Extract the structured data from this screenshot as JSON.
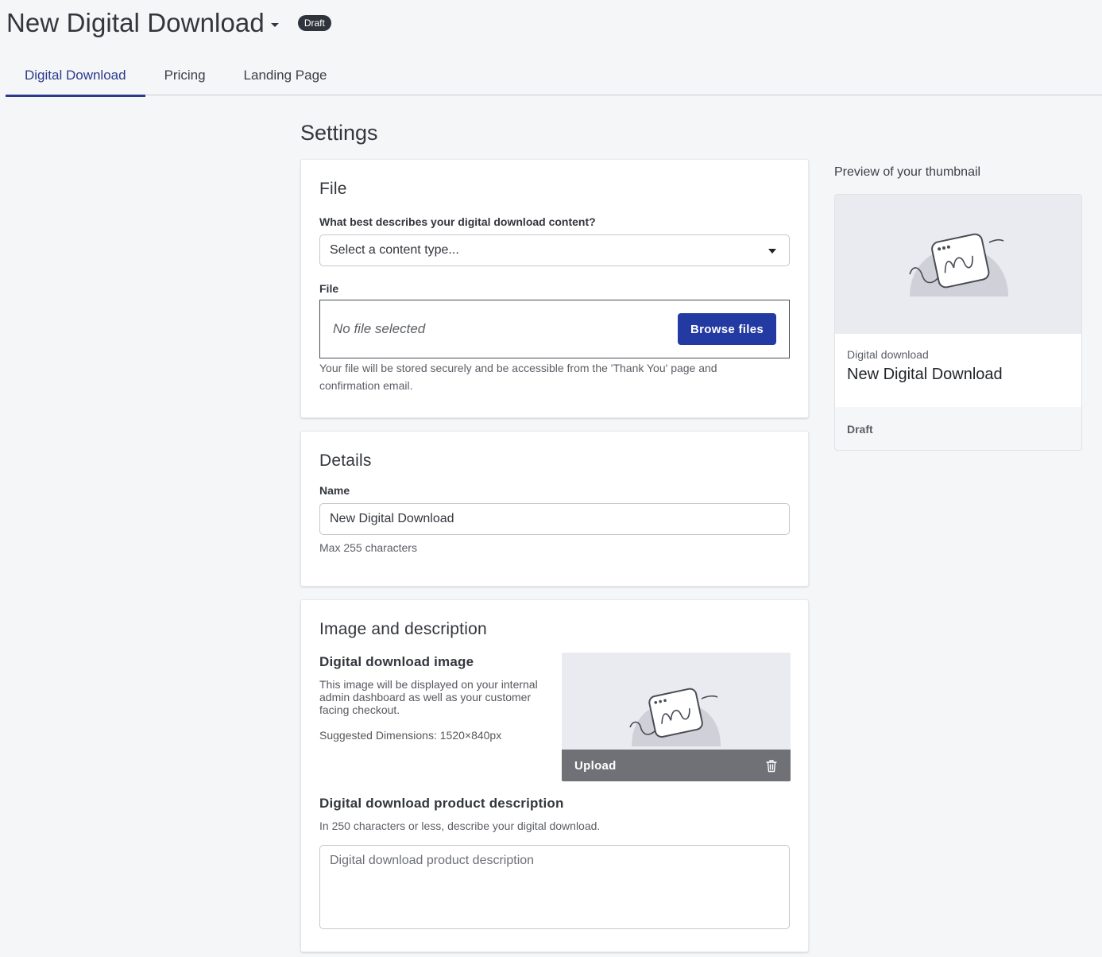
{
  "header": {
    "title": "New Digital Download",
    "status": "Draft"
  },
  "tabs": [
    {
      "label": "Digital Download",
      "active": true
    },
    {
      "label": "Pricing",
      "active": false
    },
    {
      "label": "Landing Page",
      "active": false
    }
  ],
  "settings": {
    "title": "Settings",
    "file_card": {
      "title": "File",
      "content_type_label": "What best describes your digital download content?",
      "content_type_value": "Select a content type...",
      "file_label": "File",
      "file_value": "No file selected",
      "browse_label": "Browse files",
      "help": "Your file will be stored securely and be accessible from the 'Thank You' page and confirmation email."
    },
    "details_card": {
      "title": "Details",
      "name_label": "Name",
      "name_value": "New Digital Download",
      "name_help": "Max 255 characters"
    },
    "image_card": {
      "title": "Image and description",
      "image_heading": "Digital download image",
      "image_help": "This image will be displayed on your internal admin dashboard as well as your customer facing checkout.",
      "dimensions": "Suggested Dimensions: 1520×840px",
      "upload_label": "Upload",
      "description_heading": "Digital download product description",
      "description_help": "In 250 characters or less, describe your digital download.",
      "description_placeholder": "Digital download product description"
    }
  },
  "preview": {
    "label": "Preview of your thumbnail",
    "kind": "Digital download",
    "name": "New Digital Download",
    "status": "Draft"
  },
  "colors": {
    "accent": "#233aa3",
    "tab_active": "#2a3b8f",
    "status_pill": "#2f343c",
    "upload_bar": "#6f7176"
  },
  "icons": [
    "chevron-down-icon",
    "trash-icon",
    "image-placeholder-icon"
  ]
}
